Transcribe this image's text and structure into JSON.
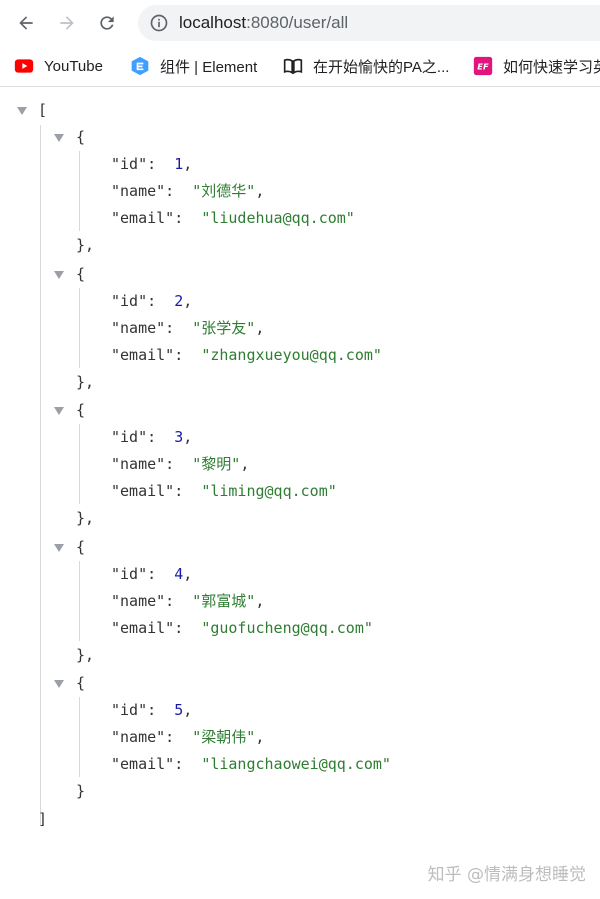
{
  "browser": {
    "url_host": "localhost",
    "url_rest": ":8080/user/all"
  },
  "bookmarks": [
    {
      "label": "YouTube",
      "icon": "youtube-icon"
    },
    {
      "label": "组件 | Element",
      "icon": "element-icon"
    },
    {
      "label": "在开始愉快的PA之...",
      "icon": "book-icon"
    },
    {
      "label": "如何快速学习英",
      "icon": "ef-icon"
    }
  ],
  "json": {
    "users": [
      {
        "id": "1",
        "name": "\"刘德华\"",
        "email": "\"liudehua@qq.com\""
      },
      {
        "id": "2",
        "name": "\"张学友\"",
        "email": "\"zhangxueyou@qq.com\""
      },
      {
        "id": "3",
        "name": "\"黎明\"",
        "email": "\"liming@qq.com\""
      },
      {
        "id": "4",
        "name": "\"郭富城\"",
        "email": "\"guofucheng@qq.com\""
      },
      {
        "id": "5",
        "name": "\"梁朝伟\"",
        "email": "\"liangchaowei@qq.com\""
      }
    ],
    "key_id": "\"id\":",
    "key_name": "\"name\":",
    "key_email": "\"email\":"
  },
  "watermark": "知乎 @情满身想睡觉"
}
